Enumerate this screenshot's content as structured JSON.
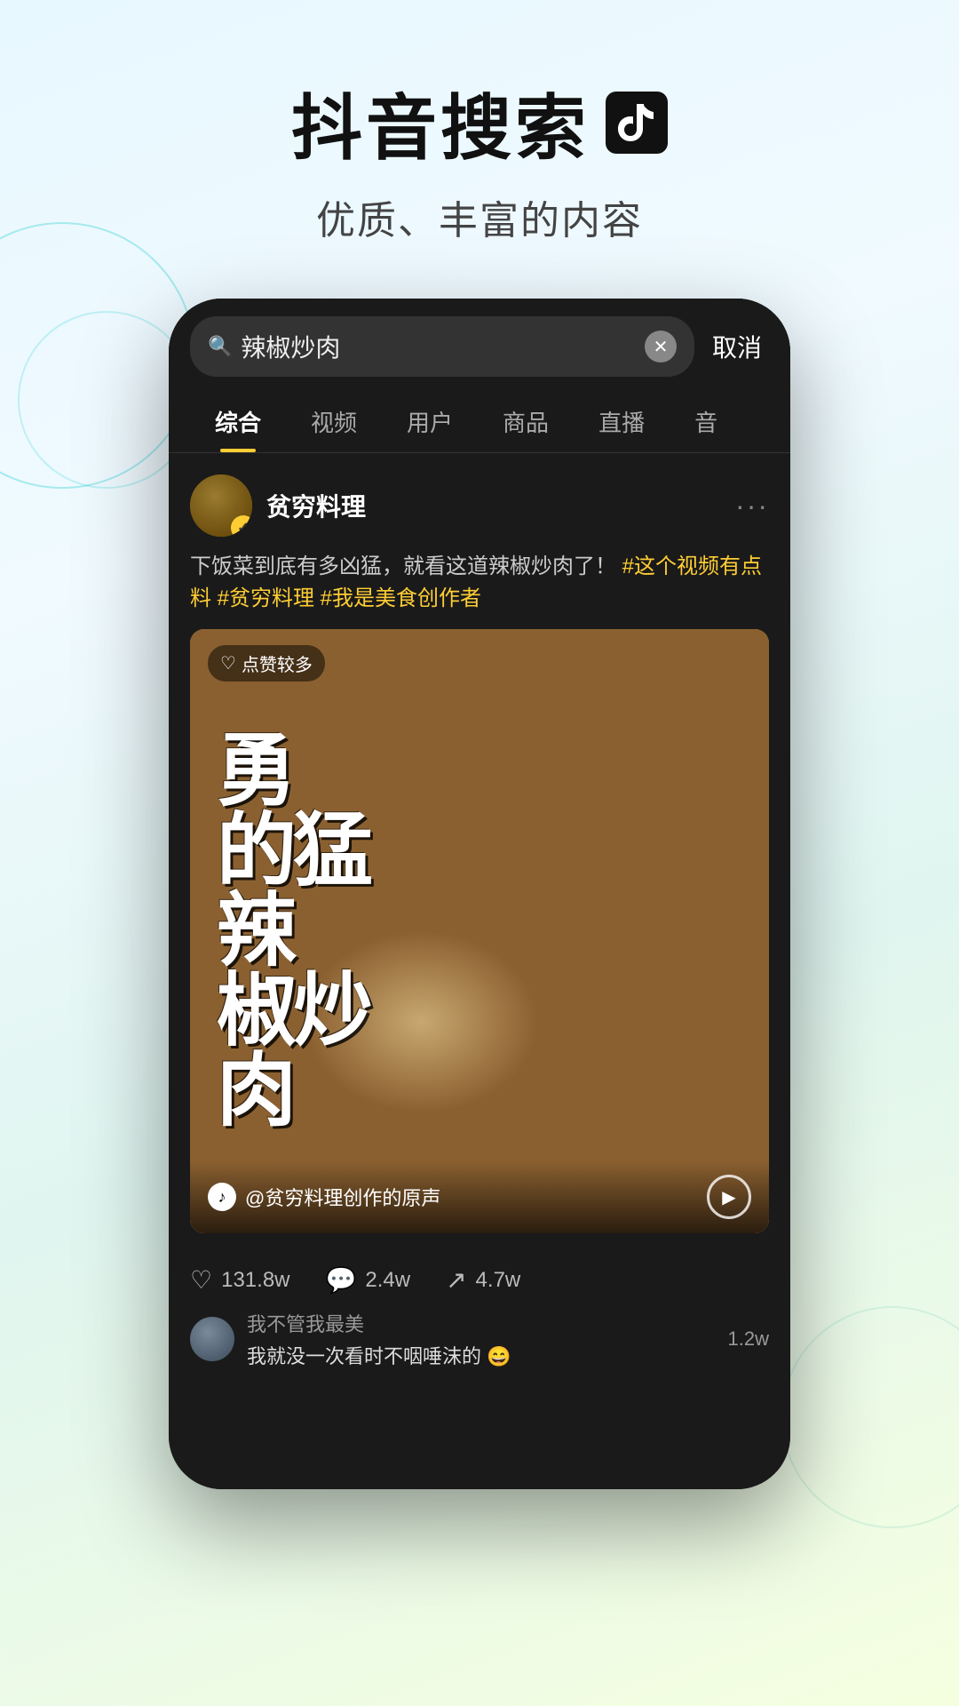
{
  "page": {
    "background": "light-blue-green gradient"
  },
  "header": {
    "main_title": "抖音搜索",
    "subtitle": "优质、丰富的内容"
  },
  "phone": {
    "search_bar": {
      "query": "辣椒炒肉",
      "cancel_label": "取消"
    },
    "tabs": [
      {
        "label": "综合",
        "active": true
      },
      {
        "label": "视频",
        "active": false
      },
      {
        "label": "用户",
        "active": false
      },
      {
        "label": "商品",
        "active": false
      },
      {
        "label": "直播",
        "active": false
      },
      {
        "label": "音",
        "active": false
      }
    ],
    "post": {
      "username": "贫穷料理",
      "verified": true,
      "text_normal": "下饭菜到底有多凶猛，就看这道辣椒炒肉了！",
      "text_tags": "#这个视频有点料 #贫穷料理 #我是美食创作者",
      "likes_badge": "点赞较多",
      "video_title_chars": "勇\n的猛\n辣\n椒炒\n肉",
      "sound_text": "@贫穷料理创作的原声",
      "stats": {
        "likes": "131.8w",
        "comments": "2.4w",
        "shares": "4.7w"
      }
    },
    "comments": [
      {
        "user": "我不管我最美",
        "text": "我就没一次看时不咽唾沫的 😄",
        "count": "1.2w"
      }
    ]
  }
}
